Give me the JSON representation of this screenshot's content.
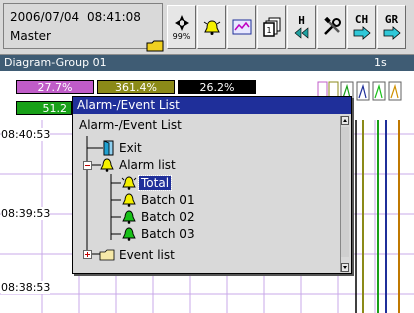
{
  "status": {
    "date": "2006/07/04",
    "time": "08:41:08",
    "user": "Master"
  },
  "toolbar": {
    "buttons": [
      {
        "icon": "compass-icon",
        "caption": "99%"
      },
      {
        "icon": "alarm-bell-icon",
        "caption": ""
      },
      {
        "icon": "chart-icon",
        "caption": ""
      },
      {
        "icon": "display-select-icon",
        "caption": ""
      },
      {
        "icon": "history-icon",
        "caption": "H"
      },
      {
        "icon": "tools-icon",
        "caption": ""
      },
      {
        "icon": "channel-next-icon",
        "caption": "CH"
      },
      {
        "icon": "group-next-icon",
        "caption": "GR"
      }
    ]
  },
  "group_bar": {
    "title": "Diagram-Group 01",
    "interval": "1s"
  },
  "values": [
    {
      "text": "27.7%",
      "bg": "#c05cc8",
      "fg": "#ffffff"
    },
    {
      "text": "361.4%",
      "bg": "#8b8a18",
      "fg": "#ffffff"
    },
    {
      "text": "26.2%",
      "bg": "#000000",
      "fg": "#ffffff"
    },
    {
      "text": "51.2",
      "bg": "#18a018",
      "fg": "#ffffff"
    }
  ],
  "chart": {
    "times": [
      "08:40:53",
      "08:39:53",
      "08:38:53"
    ]
  },
  "dialog": {
    "title": "Alarm-/Event List",
    "tree_heading": "Alarm-/Event List",
    "items": [
      {
        "label": "Exit",
        "icon": "exit-door-icon"
      },
      {
        "label": "Alarm list",
        "icon": "alarm-bell-icon"
      },
      {
        "label": "Total",
        "icon": "alarm-bell-icon"
      },
      {
        "label": "Batch 01",
        "icon": "alarm-bell-green-icon"
      },
      {
        "label": "Batch 02",
        "icon": "alarm-bell-green-icon"
      },
      {
        "label": "Batch 03",
        "icon": "alarm-bell-green-icon"
      },
      {
        "label": "Event list",
        "icon": "folder-icon"
      }
    ]
  },
  "colors": {
    "accent": "#1f2f9a",
    "group_bar": "#3f5c74",
    "alarm_yellow": "#f4f000",
    "ok_green": "#18c018"
  }
}
